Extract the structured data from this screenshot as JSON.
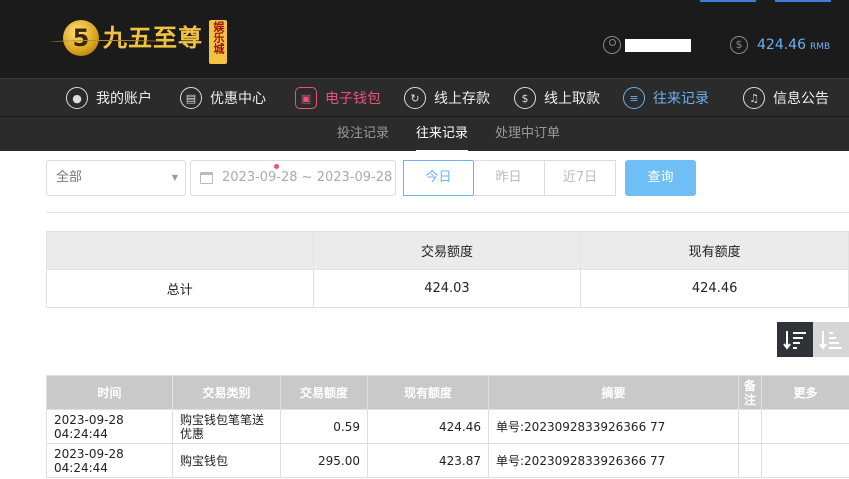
{
  "brand": {
    "coin_glyph": "5",
    "name": "九五至尊",
    "badge": "娱乐城",
    "colors": {
      "gold": "#f1c340",
      "badge_text": "#a01010"
    }
  },
  "header": {
    "balance_value": "424.46",
    "balance_currency": "RMB",
    "user_icon": "user-icon",
    "balance_icon": "dollar-coin-icon"
  },
  "mainnav": {
    "items": [
      {
        "label": "我的账户",
        "icon": "user-icon"
      },
      {
        "label": "优惠中心",
        "icon": "gift-icon"
      },
      {
        "label": "电子钱包",
        "icon": "wallet-icon"
      },
      {
        "label": "线上存款",
        "icon": "deposit-icon"
      },
      {
        "label": "线上取款",
        "icon": "withdraw-icon"
      },
      {
        "label": "往来记录",
        "icon": "record-icon"
      },
      {
        "label": "信息公告",
        "icon": "bell-icon"
      }
    ],
    "colors": {
      "highlight_red": "#e8547a",
      "active_blue": "#6bb2f0"
    }
  },
  "subnav": {
    "items": [
      {
        "label": "投注记录"
      },
      {
        "label": "往来记录"
      },
      {
        "label": "处理中订单"
      }
    ]
  },
  "filters": {
    "type_select": "全部",
    "date_range": "2023-09-28 ~ 2023-09-28",
    "quick_ranges": [
      "今日",
      "昨日",
      "近7日"
    ],
    "query_label": "查询"
  },
  "summary": {
    "headers": [
      "",
      "交易额度",
      "现有额度"
    ],
    "row": {
      "label": "总计",
      "transaction": "424.03",
      "current": "424.46"
    }
  },
  "records": {
    "headers": [
      "时间",
      "交易类别",
      "交易额度",
      "现有额度",
      "摘要",
      "备注",
      "更多"
    ],
    "rows": [
      {
        "time": "2023-09-28 04:24:44",
        "type": "购宝钱包笔笔送优惠",
        "amount": "0.59",
        "balance": "424.46",
        "summary": "单号:2023092833926366 77",
        "note": "",
        "more": ""
      },
      {
        "time": "2023-09-28 04:24:44",
        "type": "购宝钱包",
        "amount": "295.00",
        "balance": "423.87",
        "summary": "单号:2023092833926366 77",
        "note": "",
        "more": ""
      }
    ]
  },
  "sort": {
    "desc_icon": "sort-desc-icon",
    "asc_icon": "sort-asc-icon"
  }
}
